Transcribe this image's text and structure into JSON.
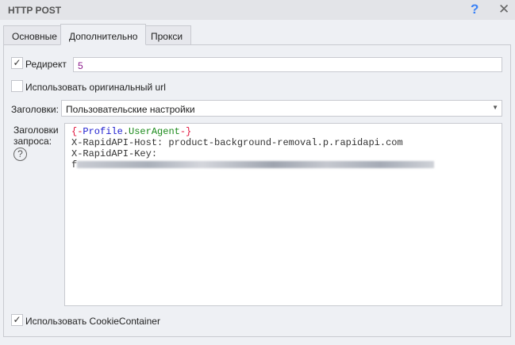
{
  "window": {
    "title": "HTTP POST"
  },
  "tabs": [
    {
      "label": "Основные"
    },
    {
      "label": "Дополнительно"
    },
    {
      "label": "Прокси"
    }
  ],
  "redirect": {
    "label": "Редирект",
    "checked": true,
    "value": "5"
  },
  "original_url": {
    "label": "Использовать оригинальный url",
    "checked": false
  },
  "headers": {
    "label": "Заголовки:",
    "selected": "Пользовательские настройки"
  },
  "request_headers": {
    "label_line1": "Заголовки",
    "label_line2": "запроса:",
    "var_open": "{-",
    "var_profile": "Profile",
    "var_dot": ".",
    "var_name": "UserAgent",
    "var_close": "-}",
    "line2": "X-RapidAPI-Host: product-background-removal.p.rapidapi.com",
    "line3": "X-RapidAPI-Key:",
    "line4_prefix": "f"
  },
  "cookie": {
    "label": "Использовать CookieContainer",
    "checked": true
  },
  "checkmark": "✓"
}
